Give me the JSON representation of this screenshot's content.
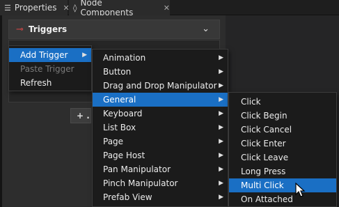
{
  "tabs": [
    {
      "label": "Properties",
      "icon": "list-icon"
    },
    {
      "label": "Node Components",
      "icon": "node-components-icon"
    }
  ],
  "panel": {
    "section_title": "Triggers",
    "add_button_label": "+ ."
  },
  "context_menu": [
    {
      "label": "Add Trigger",
      "state": "active",
      "submenu": true
    },
    {
      "label": "Paste Trigger",
      "state": "disabled",
      "submenu": false
    },
    {
      "label": "Refresh",
      "state": "normal",
      "submenu": false
    }
  ],
  "trigger_categories": [
    "Animation",
    "Button",
    "Drag and Drop Manipulator",
    "General",
    "Keyboard",
    "List Box",
    "Page",
    "Page Host",
    "Pan Manipulator",
    "Pinch Manipulator",
    "Prefab View"
  ],
  "active_category": "General",
  "general_triggers": [
    "Click",
    "Click Begin",
    "Click Cancel",
    "Click Enter",
    "Click Leave",
    "Long Press",
    "Multi Click",
    "On Attached"
  ],
  "active_trigger": "Multi Click",
  "colors": {
    "highlight": "#1a6fc4",
    "trigger_icon": "#e04848"
  }
}
